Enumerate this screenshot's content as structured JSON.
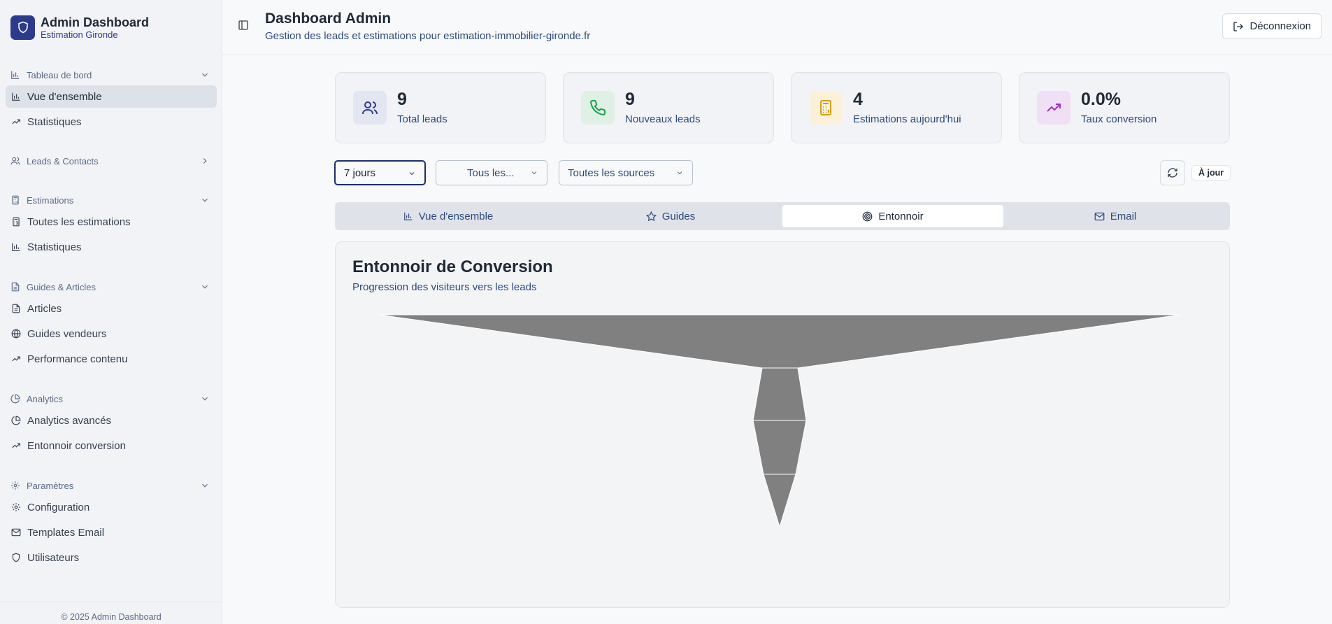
{
  "app": {
    "title": "Admin Dashboard",
    "subtitle": "Estimation Gironde",
    "footer": "© 2025 Admin Dashboard"
  },
  "sidebar": {
    "sections": [
      {
        "label": "Tableau de bord",
        "icon": "bar-chart-icon",
        "expanded": true,
        "items": [
          {
            "label": "Vue d'ensemble",
            "icon": "bar-chart-icon",
            "active": true
          },
          {
            "label": "Statistiques",
            "icon": "trending-up-icon"
          }
        ]
      },
      {
        "label": "Leads & Contacts",
        "icon": "users-icon",
        "expanded": false,
        "items": []
      },
      {
        "label": "Estimations",
        "icon": "calculator-icon",
        "expanded": true,
        "items": [
          {
            "label": "Toutes les estimations",
            "icon": "calculator-icon"
          },
          {
            "label": "Statistiques",
            "icon": "bar-chart-icon"
          }
        ]
      },
      {
        "label": "Guides & Articles",
        "icon": "file-text-icon",
        "expanded": true,
        "items": [
          {
            "label": "Articles",
            "icon": "file-text-icon"
          },
          {
            "label": "Guides vendeurs",
            "icon": "globe-icon"
          },
          {
            "label": "Performance contenu",
            "icon": "trending-up-icon"
          }
        ]
      },
      {
        "label": "Analytics",
        "icon": "pie-chart-icon",
        "expanded": true,
        "items": [
          {
            "label": "Analytics avancés",
            "icon": "pie-chart-icon"
          },
          {
            "label": "Entonnoir conversion",
            "icon": "trending-up-icon"
          }
        ]
      },
      {
        "label": "Paramètres",
        "icon": "gear-icon",
        "expanded": true,
        "items": [
          {
            "label": "Configuration",
            "icon": "gear-icon"
          },
          {
            "label": "Templates Email",
            "icon": "mail-icon"
          },
          {
            "label": "Utilisateurs",
            "icon": "shield-icon"
          }
        ]
      }
    ]
  },
  "header": {
    "title": "Dashboard Admin",
    "subtitle": "Gestion des leads et estimations pour estimation-immobilier-gironde.fr",
    "logout_label": "Déconnexion"
  },
  "stats": [
    {
      "value": "9",
      "label": "Total leads",
      "icon": "users-icon",
      "bg": "#e2e6f0",
      "fg": "#2d3a8c"
    },
    {
      "value": "9",
      "label": "Nouveaux leads",
      "icon": "phone-icon",
      "bg": "#dff1e5",
      "fg": "#16a34a"
    },
    {
      "value": "4",
      "label": "Estimations aujourd'hui",
      "icon": "calculator-icon",
      "bg": "#fbf0d9",
      "fg": "#d4a017"
    },
    {
      "value": "0.0%",
      "label": "Taux conversion",
      "icon": "trending-up-icon",
      "bg": "#f0dff5",
      "fg": "#9b30c8"
    }
  ],
  "filters": {
    "period": "7 jours",
    "category": "Tous les...",
    "source": "Toutes les sources",
    "status_badge": "À jour"
  },
  "tabs": [
    {
      "label": "Vue d'ensemble",
      "icon": "bar-chart-icon",
      "active": false
    },
    {
      "label": "Guides",
      "icon": "star-icon",
      "active": false
    },
    {
      "label": "Entonnoir",
      "icon": "target-icon",
      "active": true
    },
    {
      "label": "Email",
      "icon": "mail-icon",
      "active": false
    }
  ],
  "funnel": {
    "title": "Entonnoir de Conversion",
    "subtitle": "Progression des visiteurs vers les leads",
    "fill": "#808080",
    "stroke": "#ffffff"
  }
}
